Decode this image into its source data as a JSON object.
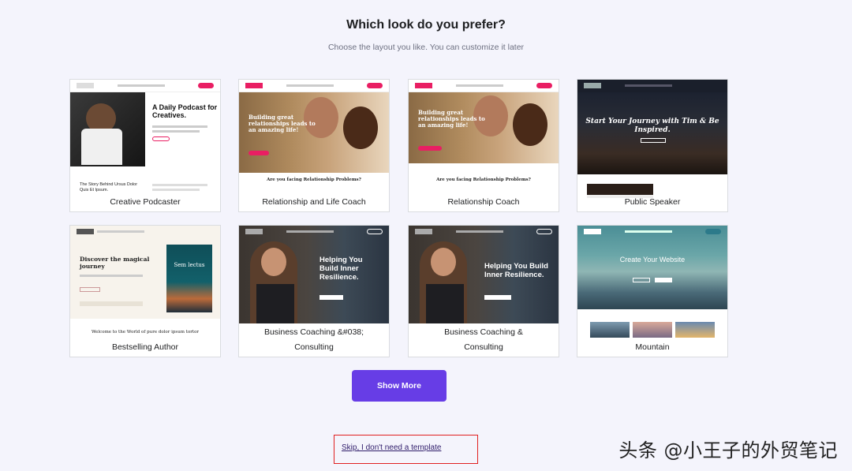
{
  "header": {
    "title": "Which look do you prefer?",
    "subtitle": "Choose the layout you like. You can customize it later"
  },
  "templates": [
    {
      "name": "Creative Podcaster",
      "thumb_title": "A Daily Podcast for Creatives.",
      "thumb_sub": "The Story Behind Ursus Dolor Quis Et Ipsum."
    },
    {
      "name": "Relationship and Life Coach",
      "thumb_title": "Building great relationships leads to an amazing life!",
      "thumb_sub": "Are you facing Relationship Problems?"
    },
    {
      "name": "Relationship Coach",
      "thumb_title": "Building great relationships leads to an amazing life!",
      "thumb_sub": "Are you facing Relationship Problems?"
    },
    {
      "name": "Public Speaker",
      "thumb_title": "Start Your Journey with Tim & Be Inspired."
    },
    {
      "name": "Bestselling Author",
      "thumb_title": "Discover the magical journey",
      "thumb_book": "Sem lectus",
      "thumb_sub": "Welcome to the World of pure dolor ipsum tortor"
    },
    {
      "name_line1": "Business Coaching &#038;",
      "name_line2": "Consulting",
      "thumb_title": "Helping You Build Inner Resilience."
    },
    {
      "name_line1": "Business Coaching &",
      "name_line2": "Consulting",
      "thumb_title": "Helping You Build Inner Resilience."
    },
    {
      "name": "Mountain",
      "thumb_title": "Create Your Website"
    }
  ],
  "actions": {
    "show_more": "Show More",
    "skip": "Skip, I don't need a template"
  },
  "watermark": "头条 @小王子的外贸笔记",
  "colors": {
    "accent": "#673de6",
    "highlight_border": "#e02020",
    "background": "#f4f4fc"
  }
}
